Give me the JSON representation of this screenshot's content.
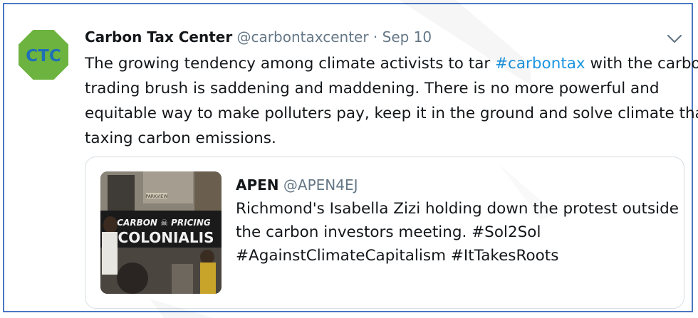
{
  "tweet": {
    "avatar_text": "CTC",
    "display_name": "Carbon Tax Center",
    "handle": "@carbontaxcenter",
    "separator": " · ",
    "date": "Sep 10",
    "text_lines": [
      [
        "The growing tendency among climate activists to tar ",
        "#carbontax",
        " with the carbon-"
      ],
      "trading brush is saddening and maddening. There is no more powerful and",
      "equitable way to make polluters pay, keep it in the ground and solve climate than",
      "taxing carbon emissions."
    ]
  },
  "quoted_tweet": {
    "display_name": "APEN",
    "handle": "@APEN4EJ",
    "image_sign_line1": "CARBON ☠ PRICING",
    "image_sign_line2": "COLONIALIS",
    "image_building_sign": "PARKVIEW",
    "text_lines": [
      "Richmond's Isabella Zizi holding down the protest outside",
      "the carbon investors meeting. #Sol2Sol",
      "#AgainstClimateCapitalism #ItTakesRoots"
    ]
  },
  "colors": {
    "hashtag": "#1b95e0",
    "avatar_green": "#6cb33f",
    "avatar_text": "#1f6fb8",
    "frame_border": "#4a78c2",
    "muted_text": "#657786"
  },
  "icons": {
    "menu": "chevron-down-icon"
  }
}
